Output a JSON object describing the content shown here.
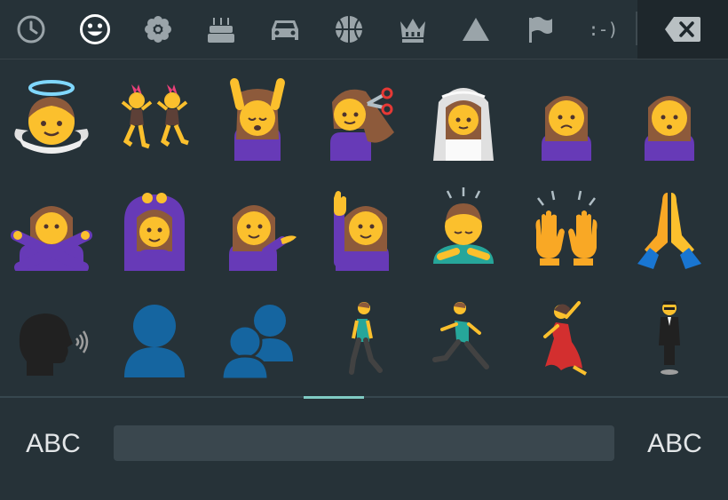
{
  "category_bar": {
    "items": [
      {
        "icon": "recent-clock-icon"
      },
      {
        "icon": "smiley-face-icon",
        "active": true
      },
      {
        "icon": "flower-icon"
      },
      {
        "icon": "birthday-cake-icon"
      },
      {
        "icon": "car-icon"
      },
      {
        "icon": "basketball-icon"
      },
      {
        "icon": "crown-icon"
      },
      {
        "icon": "triangle-icon"
      },
      {
        "icon": "flag-icon"
      },
      {
        "icon": "emoticon-text",
        "text": ":-)"
      }
    ],
    "backspace_icon": "backspace-icon"
  },
  "emoji_grid": {
    "rows": [
      [
        "angel",
        "women-with-bunny-ears",
        "woman-getting-massage",
        "woman-getting-haircut",
        "bride-with-veil",
        "woman-frowning",
        "woman-pouting"
      ],
      [
        "woman-gesturing-no",
        "woman-gesturing-ok",
        "woman-tipping-hand",
        "woman-raising-hand",
        "person-bowing",
        "raising-hands",
        "folded-hands"
      ],
      [
        "speaking-head",
        "bust-in-silhouette",
        "busts-in-silhouette",
        "person-walking",
        "person-running",
        "woman-dancing",
        "man-in-business-suit-levitating"
      ]
    ]
  },
  "page_indicator": {
    "current_page": 1
  },
  "bottom_bar": {
    "left_label": "ABC",
    "right_label": "ABC"
  },
  "colors": {
    "background": "#263238",
    "icon_inactive": "#9aa4a9",
    "icon_active": "#ffffff",
    "indicator": "#80cbc4",
    "skin": "#fbc02d",
    "hair": "#8d5a3b",
    "purple": "#673ab7",
    "silhouette": "#1565a0"
  }
}
